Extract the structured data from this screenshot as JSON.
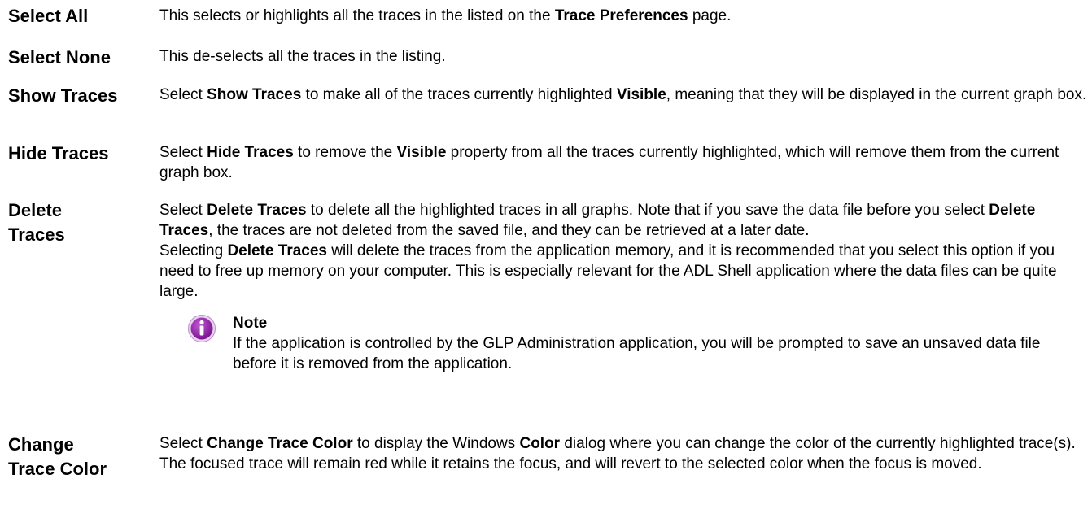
{
  "entries": [
    {
      "term_line1": "Select All",
      "desc": [
        {
          "t": "This selects or highlights all the traces in the listed on the "
        },
        {
          "b": "Trace Preferences"
        },
        {
          "t": " page."
        }
      ]
    },
    {
      "term_line1": "Select None",
      "desc": [
        {
          "t": "This de-selects all the traces in the listing."
        }
      ]
    },
    {
      "term_line1": "Show Traces",
      "desc": [
        {
          "t": "Select "
        },
        {
          "b": "Show Traces"
        },
        {
          "t": " to make all of the traces currently highlighted "
        },
        {
          "b": "Visible"
        },
        {
          "t": ", meaning that they will be displayed in the current graph box."
        }
      ]
    },
    {
      "term_line1": "Hide Traces",
      "desc": [
        {
          "t": "Select "
        },
        {
          "b": "Hide Traces"
        },
        {
          "t": " to remove the "
        },
        {
          "b": "Visible"
        },
        {
          "t": " property from all the traces currently highlighted, which will remove them from the current graph box."
        }
      ]
    },
    {
      "term_line1": "Delete",
      "term_line2": "Traces",
      "desc": [
        {
          "t": "Select "
        },
        {
          "b": "Delete Traces"
        },
        {
          "t": " to delete all the highlighted traces in all graphs. Note that if you save the data file before you select "
        },
        {
          "b": "Delete Traces"
        },
        {
          "t": ", the traces are not deleted from the saved file, and they can be retrieved at a later date."
        }
      ],
      "desc2": [
        {
          "t": "Selecting "
        },
        {
          "b": "Delete Traces"
        },
        {
          "t": " will delete the traces from the application memory, and it is recommended that you select this option if you need to free up memory on your computer. This is especially relevant for the ADL Shell application where the data files can be quite large."
        }
      ]
    },
    {
      "term_line1": "Change",
      "term_line2": "Trace Color",
      "desc": [
        {
          "t": "Select "
        },
        {
          "b": "Change Trace Color"
        },
        {
          "t": " to display the Windows "
        },
        {
          "b": "Color"
        },
        {
          "t": " dialog where you can change the color of the currently highlighted trace(s). The focused trace will remain red while it retains the focus, and will revert to the selected color when the focus is moved."
        }
      ]
    }
  ],
  "note": {
    "icon": "info-icon",
    "title": "Note",
    "body": "If the application is controlled by the GLP Administration application, you will be prompted to save an unsaved data file before it is removed from the application."
  },
  "colors": {
    "text": "#000000",
    "icon_fill": "#8b1aa6",
    "icon_rim": "#d6b3e0"
  }
}
